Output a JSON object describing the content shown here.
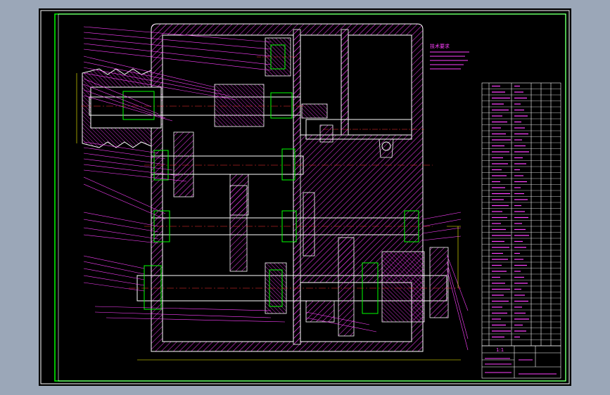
{
  "viewport": {
    "background": "#000000"
  },
  "colors": {
    "frame": "#ffffff",
    "border": "#00ff00",
    "part": "#ff40ff",
    "bearing": "#00ff00",
    "shaft": "#ffffff",
    "center": "#ff3030",
    "dim": "#ffff00",
    "hatch": "#ff40ff"
  },
  "title_block": {
    "scale": "1:1",
    "drawing_name": "",
    "company": ""
  },
  "tech_requirements_title": "技术要求"
}
